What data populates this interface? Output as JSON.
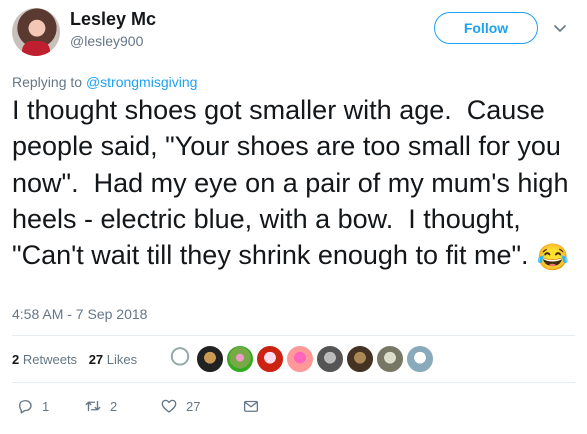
{
  "tweet": {
    "author_name": "Lesley Mc",
    "author_handle": "@lesley900",
    "follow_label": "Follow",
    "replying_prefix": "Replying to",
    "replying_to": "@strongmisgiving",
    "text": "I thought shoes got smaller with age.  Cause people said, \"Your shoes are too small for you now\".  Had my eye on a pair of my mum's high heels - electric blue, with a bow.  I thought, \"Can't wait till they shrink enough to fit me\".",
    "emoji": "😂",
    "timestamp": "4:58 AM - 7 Sep 2018"
  },
  "stats": {
    "retweets_count": "2",
    "retweets_label": "Retweets",
    "likes_count": "27",
    "likes_label": "Likes"
  },
  "actions": {
    "reply_count": "1",
    "retweet_count": "2",
    "like_count": "27"
  },
  "colors": {
    "accent": "#1da1f2",
    "muted": "#657786",
    "text": "#14171a",
    "divider": "#e6ecf0"
  },
  "icons": [
    "chevron-down-icon",
    "reply-icon",
    "retweet-icon",
    "heart-icon",
    "message-icon"
  ]
}
